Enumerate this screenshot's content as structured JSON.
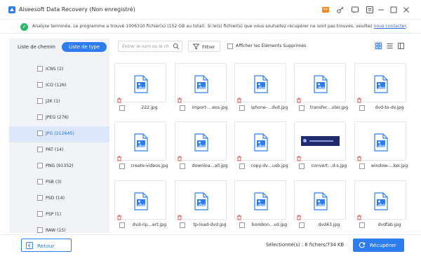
{
  "window": {
    "title": "Aiseesoft Data Recovery (Non enregistré)"
  },
  "titlebar_icons": [
    "cart-icon",
    "key-icon",
    "chat-icon",
    "menu-icon",
    "minimize-icon",
    "maximize-icon",
    "close-icon"
  ],
  "notice": {
    "text": "Analyse terminée. Le programme a trouvé 1006310 fichier(s) (152 GB au total). Si le(s) fichier(s) que vous souhaitez récupérer ne sont pas trouvés, veuillez ",
    "link": "nous contacter",
    "suffix": "."
  },
  "tabs": {
    "path_label": "Liste de chemin",
    "type_label": "Liste de type"
  },
  "type_list": [
    {
      "label": "ICNS (2)"
    },
    {
      "label": "ICO (126)"
    },
    {
      "label": "J2K (1)"
    },
    {
      "label": "JPEG (276)"
    },
    {
      "label": "JPG (212645)",
      "active": true
    },
    {
      "label": "PAT (14)"
    },
    {
      "label": "PNG (91352)"
    },
    {
      "label": "PSB (3)"
    },
    {
      "label": "PSD (14)"
    },
    {
      "label": "PSP (1)"
    },
    {
      "label": "RAW (15)"
    }
  ],
  "toolbar": {
    "search_placeholder": "Entrer le nom ou le ch",
    "filter_label": "Filtrer",
    "show_deleted_label": "Afficher les Éléments Supprimés"
  },
  "files": [
    {
      "name": "222.jpg"
    },
    {
      "name": "import-…eos.jpg"
    },
    {
      "name": "iphone-…dvd.jpg"
    },
    {
      "name": "transfer…uter.jpg"
    },
    {
      "name": "dvd-to-dv.jpg"
    },
    {
      "name": "create-videos.jpg"
    },
    {
      "name": "downloa…all.jpg"
    },
    {
      "name": "copy-dv…usb.jpg"
    },
    {
      "name": "convert…d-s.jpg",
      "preview": true
    },
    {
      "name": "window-…ker.jpg"
    },
    {
      "name": "dvd-rip…ert.jpg"
    },
    {
      "name": "tp-load-dvd.jpg"
    },
    {
      "name": "bombon…vd.jpg"
    },
    {
      "name": "dvd43.jpg"
    },
    {
      "name": "dvdfab.jpg"
    }
  ],
  "footer": {
    "back_label": "Retour",
    "selected_text": "Sélectionné(s) : 6 fichers/734 KB",
    "recover_label": "Récupérer"
  },
  "colors": {
    "accent": "#2d7df0",
    "success": "#2fb86a",
    "sidebar_bg": "#f1f3f7",
    "active_row": "#dce7fb",
    "trash": "#e0524a"
  }
}
